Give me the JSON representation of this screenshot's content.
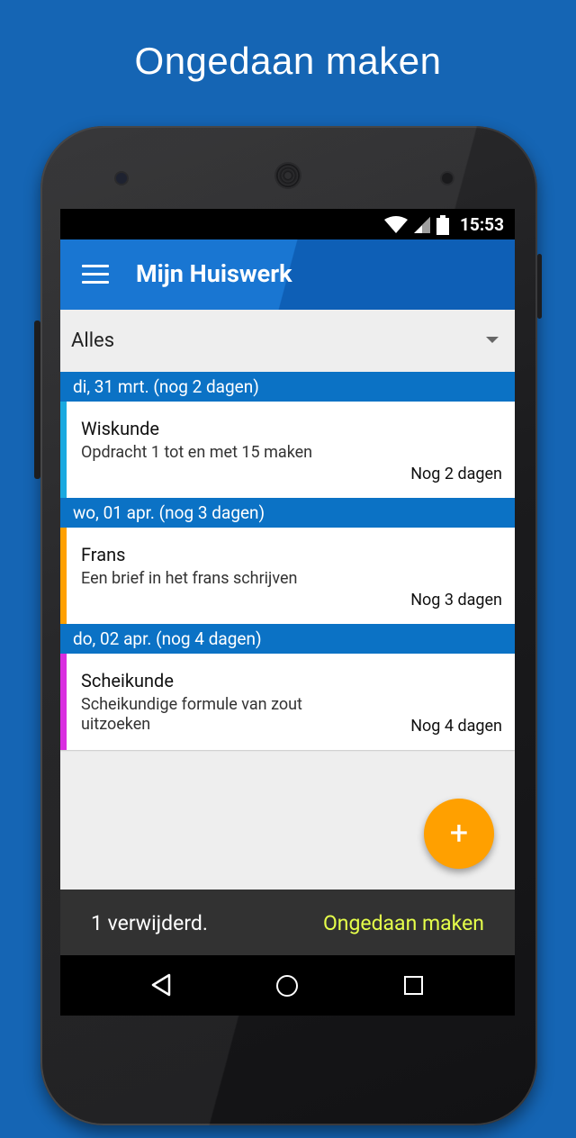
{
  "promo": {
    "headline": "Ongedaan maken"
  },
  "statusbar": {
    "time": "15:53",
    "icons": [
      "wifi-icon",
      "signal-icon",
      "battery-icon"
    ]
  },
  "appbar": {
    "title": "Mijn Huiswerk",
    "menu_icon": "menu-icon"
  },
  "filter": {
    "selected": "Alles"
  },
  "groups": [
    {
      "header": "di, 31 mrt. (nog 2 dagen)",
      "item": {
        "subject": "Wiskunde",
        "description": "Opdracht 1 tot en met 15 maken",
        "due": "Nog 2 dagen",
        "color": "#1aa9e0"
      }
    },
    {
      "header": "wo, 01 apr. (nog 3 dagen)",
      "item": {
        "subject": "Frans",
        "description": "Een brief in het frans schrijven",
        "due": "Nog 3 dagen",
        "color": "#ffa000"
      }
    },
    {
      "header": "do, 02 apr. (nog 4 dagen)",
      "item": {
        "subject": "Scheikunde",
        "description": "Scheikundige formule van zout uitzoeken",
        "due": "Nog 4 dagen",
        "color": "#d92ee0"
      }
    }
  ],
  "fab": {
    "label": "+"
  },
  "snackbar": {
    "message": "1 verwijderd.",
    "action": "Ongedaan maken"
  },
  "colors": {
    "background": "#1565b4",
    "appbar": "#1976d2",
    "group_header": "#0b72c5",
    "fab": "#ffa000",
    "snackbar_action": "#e6ff4a"
  }
}
